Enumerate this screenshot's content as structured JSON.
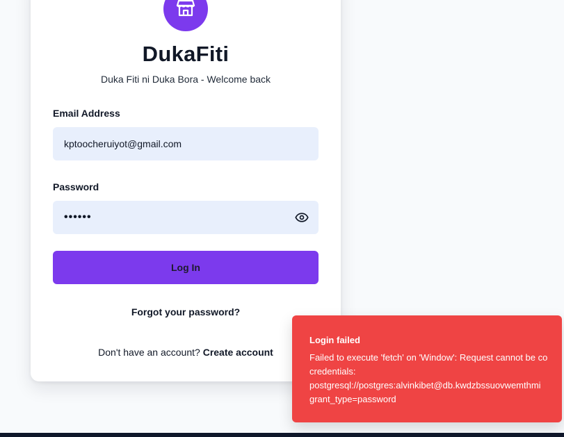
{
  "brand": {
    "name": "DukaFiti",
    "tagline": "Duka Fiti ni Duka Bora - Welcome back",
    "logo_icon": "storefront-icon",
    "accent": "#7c3aed"
  },
  "form": {
    "email_label": "Email Address",
    "email_value": "kptoocheruiyot@gmail.com",
    "password_label": "Password",
    "password_value": "••••••",
    "password_toggle_icon": "eye-icon",
    "submit_label": "Log In",
    "forgot_label": "Forgot your password?",
    "signup_prompt": "Don't have an account? ",
    "signup_link": "Create account"
  },
  "toast": {
    "title": "Login failed",
    "lines": [
      "Failed to execute 'fetch' on 'Window': Request cannot be co",
      "credentials:",
      "postgresql://postgres:alvinkibet@db.kwdzbssuovwemthmi",
      "grant_type=password"
    ],
    "color": "#ef4444"
  }
}
